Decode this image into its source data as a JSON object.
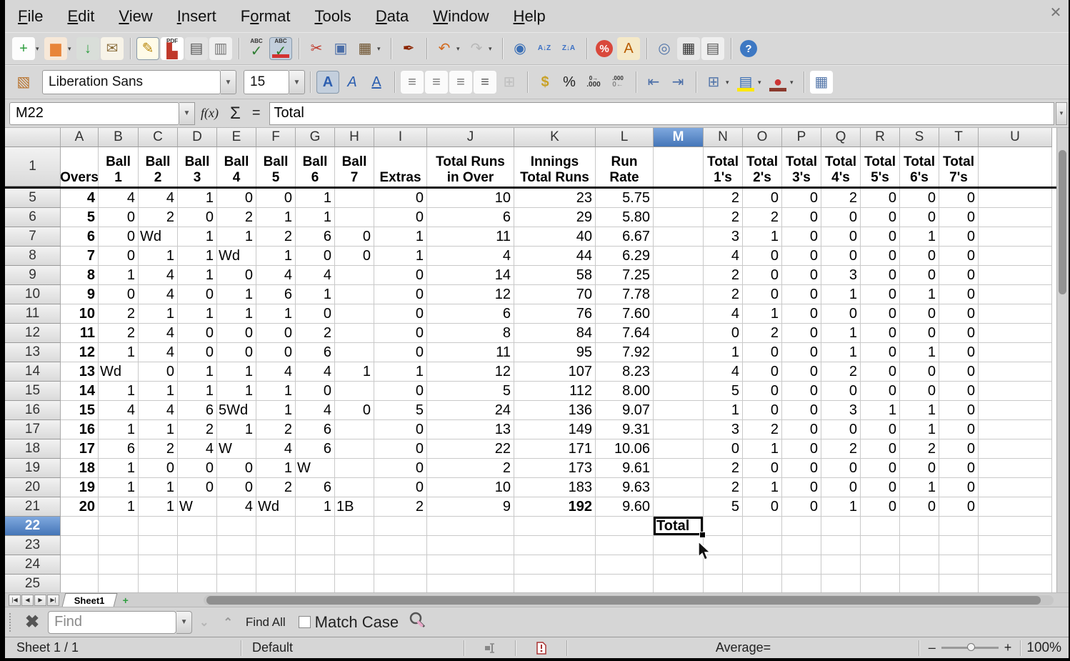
{
  "window": {
    "close_glyph": "✕"
  },
  "menu": {
    "items": [
      {
        "label": "File",
        "accel": 0
      },
      {
        "label": "Edit",
        "accel": 0
      },
      {
        "label": "View",
        "accel": 0
      },
      {
        "label": "Insert",
        "accel": 0
      },
      {
        "label": "Format",
        "accel": 1
      },
      {
        "label": "Tools",
        "accel": 0
      },
      {
        "label": "Data",
        "accel": 0
      },
      {
        "label": "Window",
        "accel": 0
      },
      {
        "label": "Help",
        "accel": 0
      }
    ]
  },
  "toolbar_standard": [
    {
      "icon": "new-document-icon",
      "glyph": "+",
      "fg": "#2e9e3f",
      "bg": "#fdfdfd",
      "dropdown": true
    },
    {
      "icon": "open-folder-icon",
      "glyph": "▆",
      "fg": "#e8853a",
      "bg": "#f7e8d8",
      "dropdown": true
    },
    {
      "icon": "save-icon",
      "glyph": "↓",
      "fg": "#2e9e3f",
      "bg": "#d9ded9"
    },
    {
      "icon": "email-icon",
      "glyph": "✉",
      "fg": "#8a6d3b",
      "bg": "#f7f3e8"
    },
    {
      "sep": true
    },
    {
      "icon": "edit-file-icon",
      "glyph": "✎",
      "fg": "#b8860b",
      "bg": "#fffbe8",
      "pressed": true
    },
    {
      "icon": "pdf-export-icon",
      "glyph": "▙",
      "top_label": "PDF",
      "fg": "#c0392b",
      "bg": "#fff"
    },
    {
      "icon": "print-icon",
      "glyph": "▤",
      "fg": "#555",
      "bg": "#e2e2e2"
    },
    {
      "icon": "print-preview-icon",
      "glyph": "▥",
      "fg": "#777",
      "bg": "#efefef"
    },
    {
      "sep": true
    },
    {
      "icon": "spellcheck-icon",
      "glyph": "✓",
      "top_label": "ABC",
      "fg": "#2e7d32"
    },
    {
      "icon": "auto-spellcheck-icon",
      "glyph": "✓",
      "top_label": "ABC",
      "fg": "#2e7d32",
      "bar": "#d33333",
      "pressed": true
    },
    {
      "sep": true
    },
    {
      "icon": "cut-icon",
      "glyph": "✂",
      "fg": "#c0392b"
    },
    {
      "icon": "copy-icon",
      "glyph": "▣",
      "fg": "#4a6da7"
    },
    {
      "icon": "paste-icon",
      "glyph": "▦",
      "fg": "#6b4f2a",
      "dropdown": true
    },
    {
      "sep": true
    },
    {
      "icon": "clone-formatting-icon",
      "glyph": "✒",
      "fg": "#8b2500"
    },
    {
      "sep": true
    },
    {
      "icon": "undo-icon",
      "glyph": "↶",
      "fg": "#d2691e",
      "dropdown": true
    },
    {
      "icon": "redo-icon",
      "glyph": "↷",
      "fg": "#888",
      "dropdown": true,
      "disabled": true
    },
    {
      "sep": true
    },
    {
      "icon": "hyperlink-icon",
      "glyph": "◉",
      "fg": "#3b6fb5"
    },
    {
      "icon": "sort-ascending-icon",
      "glyph": "A↓Z",
      "small": true,
      "fg": "#3a6fc4"
    },
    {
      "icon": "sort-descending-icon",
      "glyph": "Z↓A",
      "small": true,
      "fg": "#3a6fc4"
    },
    {
      "sep": true
    },
    {
      "icon": "chart-icon",
      "glyph": "%",
      "round": true,
      "roundbg": "#d9483b"
    },
    {
      "icon": "gallery-brush-icon",
      "glyph": "A",
      "fg": "#b85c00",
      "bg": "#f5e9c8"
    },
    {
      "sep": true
    },
    {
      "icon": "navigator-icon",
      "glyph": "◎",
      "fg": "#5577aa"
    },
    {
      "icon": "gallery-icon",
      "glyph": "▦",
      "fg": "#333",
      "bg": "#e8e8e8"
    },
    {
      "icon": "data-sources-icon",
      "glyph": "▤",
      "fg": "#555",
      "bg": "#efefef"
    },
    {
      "sep": true
    },
    {
      "icon": "help-icon",
      "glyph": "?",
      "round": true,
      "roundbg": "#3d78c3"
    }
  ],
  "toolbar_format": {
    "styles_icon": {
      "icon": "styles-icon",
      "glyph": "▧",
      "fg": "#b8722c"
    },
    "font_name": "Liberation Sans",
    "font_size": "15",
    "items": [
      {
        "sep": true
      },
      {
        "icon": "bold-icon",
        "glyph": "A",
        "fg": "#2d5fb0",
        "boldglyph": true,
        "pressed": true
      },
      {
        "icon": "italic-icon",
        "glyph": "A",
        "fg": "#2d5fb0",
        "italicglyph": true
      },
      {
        "icon": "underline-icon",
        "glyph": "A",
        "fg": "#2d5fb0",
        "underglyph": true
      },
      {
        "sep": true
      },
      {
        "icon": "align-left-icon",
        "glyph": "≡",
        "fg": "#777",
        "bg": "#fbfbfb"
      },
      {
        "icon": "align-center-icon",
        "glyph": "≡",
        "fg": "#777",
        "bg": "#fbfbfb"
      },
      {
        "icon": "align-right-icon",
        "glyph": "≡",
        "fg": "#777",
        "bg": "#fbfbfb"
      },
      {
        "icon": "align-justify-icon",
        "glyph": "≡",
        "fg": "#555",
        "bg": "#fbfbfb"
      },
      {
        "icon": "merge-cells-icon",
        "glyph": "⊞",
        "fg": "#999",
        "disabled": true
      },
      {
        "sep": true
      },
      {
        "icon": "currency-icon",
        "glyph": "$",
        "fg": "#c9a227",
        "boldglyph": true
      },
      {
        "icon": "percent-icon",
        "glyph": "%",
        "fg": "#222"
      },
      {
        "icon": "add-decimal-icon",
        "glyph": ".000",
        "small": true,
        "top_label": "0→",
        "fg": "#333"
      },
      {
        "icon": "delete-decimal-icon",
        "glyph": "0←",
        "small": true,
        "top_label": ".000",
        "fg": "#888"
      },
      {
        "sep": true
      },
      {
        "icon": "decrease-indent-icon",
        "glyph": "⇤",
        "fg": "#4a6da7"
      },
      {
        "icon": "increase-indent-icon",
        "glyph": "⇥",
        "fg": "#4a6da7"
      },
      {
        "sep": true
      },
      {
        "icon": "borders-icon",
        "glyph": "⊞",
        "fg": "#5577aa",
        "dropdown": true
      },
      {
        "icon": "background-color-icon",
        "glyph": "▤",
        "fg": "#3b6fb5",
        "bar": "#ffe800",
        "dropdown": true
      },
      {
        "icon": "border-color-icon",
        "glyph": "●",
        "fg": "#cc3333",
        "bar": "#8b3a2e",
        "dropdown": true
      },
      {
        "sep": true
      },
      {
        "icon": "conditional-formatting-icon",
        "glyph": "▦",
        "fg": "#5577aa",
        "bg": "#fff"
      }
    ]
  },
  "formula_bar": {
    "cell_reference": "M22",
    "fx_label": "f(x)",
    "sum_label": "Σ",
    "equals_label": "=",
    "content": "Total"
  },
  "spreadsheet": {
    "column_letters": [
      "A",
      "B",
      "C",
      "D",
      "E",
      "F",
      "G",
      "H",
      "I",
      "J",
      "K",
      "L",
      "M",
      "N",
      "O",
      "P",
      "Q",
      "R",
      "S",
      "T",
      "U"
    ],
    "selected_column": "M",
    "selected_row": "22",
    "cursor_cell": "M:22",
    "bold_cells": [
      "K:21",
      "M:22"
    ],
    "bold_columns": [
      "A"
    ],
    "header_row": {
      "number": "1",
      "values": [
        "Overs",
        "Ball\n1",
        "Ball\n2",
        "Ball\n3",
        "Ball\n4",
        "Ball\n5",
        "Ball\n6",
        "Ball\n7",
        "Extras",
        "Total Runs\nin Over",
        "Innings\nTotal Runs",
        "Run\nRate",
        "",
        "Total\n1's",
        "Total\n2's",
        "Total\n3's",
        "Total\n4's",
        "Total\n5's",
        "Total\n6's",
        "Total\n7's",
        ""
      ]
    },
    "rows": [
      {
        "number": "5",
        "values": [
          "4",
          "4",
          "4",
          "1",
          "0",
          "0",
          "1",
          "",
          "0",
          "10",
          "23",
          "5.75",
          "",
          "2",
          "0",
          "0",
          "2",
          "0",
          "0",
          "0",
          ""
        ]
      },
      {
        "number": "6",
        "values": [
          "5",
          "0",
          "2",
          "0",
          "2",
          "1",
          "1",
          "",
          "0",
          "6",
          "29",
          "5.80",
          "",
          "2",
          "2",
          "0",
          "0",
          "0",
          "0",
          "0",
          ""
        ]
      },
      {
        "number": "7",
        "values": [
          "6",
          "0",
          "Wd",
          "1",
          "1",
          "2",
          "6",
          "0",
          "1",
          "11",
          "40",
          "6.67",
          "",
          "3",
          "1",
          "0",
          "0",
          "0",
          "1",
          "0",
          ""
        ]
      },
      {
        "number": "8",
        "values": [
          "7",
          "0",
          "1",
          "1",
          "Wd",
          "1",
          "0",
          "0",
          "1",
          "4",
          "44",
          "6.29",
          "",
          "4",
          "0",
          "0",
          "0",
          "0",
          "0",
          "0",
          ""
        ]
      },
      {
        "number": "9",
        "values": [
          "8",
          "1",
          "4",
          "1",
          "0",
          "4",
          "4",
          "",
          "0",
          "14",
          "58",
          "7.25",
          "",
          "2",
          "0",
          "0",
          "3",
          "0",
          "0",
          "0",
          ""
        ]
      },
      {
        "number": "10",
        "values": [
          "9",
          "0",
          "4",
          "0",
          "1",
          "6",
          "1",
          "",
          "0",
          "12",
          "70",
          "7.78",
          "",
          "2",
          "0",
          "0",
          "1",
          "0",
          "1",
          "0",
          ""
        ]
      },
      {
        "number": "11",
        "values": [
          "10",
          "2",
          "1",
          "1",
          "1",
          "1",
          "0",
          "",
          "0",
          "6",
          "76",
          "7.60",
          "",
          "4",
          "1",
          "0",
          "0",
          "0",
          "0",
          "0",
          ""
        ]
      },
      {
        "number": "12",
        "values": [
          "11",
          "2",
          "4",
          "0",
          "0",
          "0",
          "2",
          "",
          "0",
          "8",
          "84",
          "7.64",
          "",
          "0",
          "2",
          "0",
          "1",
          "0",
          "0",
          "0",
          ""
        ]
      },
      {
        "number": "13",
        "values": [
          "12",
          "1",
          "4",
          "0",
          "0",
          "0",
          "6",
          "",
          "0",
          "11",
          "95",
          "7.92",
          "",
          "1",
          "0",
          "0",
          "1",
          "0",
          "1",
          "0",
          ""
        ]
      },
      {
        "number": "14",
        "values": [
          "13",
          "Wd",
          "0",
          "1",
          "1",
          "4",
          "4",
          "1",
          "1",
          "12",
          "107",
          "8.23",
          "",
          "4",
          "0",
          "0",
          "2",
          "0",
          "0",
          "0",
          ""
        ]
      },
      {
        "number": "15",
        "values": [
          "14",
          "1",
          "1",
          "1",
          "1",
          "1",
          "0",
          "",
          "0",
          "5",
          "112",
          "8.00",
          "",
          "5",
          "0",
          "0",
          "0",
          "0",
          "0",
          "0",
          ""
        ]
      },
      {
        "number": "16",
        "values": [
          "15",
          "4",
          "4",
          "6",
          "5Wd",
          "1",
          "4",
          "0",
          "5",
          "24",
          "136",
          "9.07",
          "",
          "1",
          "0",
          "0",
          "3",
          "1",
          "1",
          "0",
          ""
        ]
      },
      {
        "number": "17",
        "values": [
          "16",
          "1",
          "1",
          "2",
          "1",
          "2",
          "6",
          "",
          "0",
          "13",
          "149",
          "9.31",
          "",
          "3",
          "2",
          "0",
          "0",
          "0",
          "1",
          "0",
          ""
        ]
      },
      {
        "number": "18",
        "values": [
          "17",
          "6",
          "2",
          "4",
          "W",
          "4",
          "6",
          "",
          "0",
          "22",
          "171",
          "10.06",
          "",
          "0",
          "1",
          "0",
          "2",
          "0",
          "2",
          "0",
          ""
        ]
      },
      {
        "number": "19",
        "values": [
          "18",
          "1",
          "0",
          "0",
          "0",
          "1",
          "W",
          "",
          "0",
          "2",
          "173",
          "9.61",
          "",
          "2",
          "0",
          "0",
          "0",
          "0",
          "0",
          "0",
          ""
        ]
      },
      {
        "number": "20",
        "values": [
          "19",
          "1",
          "1",
          "0",
          "0",
          "2",
          "6",
          "",
          "0",
          "10",
          "183",
          "9.63",
          "",
          "2",
          "1",
          "0",
          "0",
          "0",
          "1",
          "0",
          ""
        ]
      },
      {
        "number": "21",
        "values": [
          "20",
          "1",
          "1",
          "W",
          "4",
          "Wd",
          "1",
          "1B",
          "2",
          "9",
          "192",
          "9.60",
          "",
          "5",
          "0",
          "0",
          "1",
          "0",
          "0",
          "0",
          ""
        ]
      },
      {
        "number": "22",
        "values": [
          "",
          "",
          "",
          "",
          "",
          "",
          "",
          "",
          "",
          "",
          "",
          "",
          "Total",
          "",
          "",
          "",
          "",
          "",
          "",
          "",
          ""
        ]
      },
      {
        "number": "23",
        "values": []
      },
      {
        "number": "24",
        "values": []
      },
      {
        "number": "25",
        "values": []
      }
    ]
  },
  "sheet_tabs": {
    "nav_glyphs": [
      "|◀",
      "◀",
      "▶",
      "▶|"
    ],
    "tabs": [
      "Sheet1"
    ],
    "add_glyph": "+"
  },
  "find_bar": {
    "close_glyph": "✖",
    "placeholder": "Find",
    "next_glyph": "⌄",
    "prev_glyph": "⌃",
    "find_all_label": "Find All",
    "match_case_label": "Match Case"
  },
  "status_bar": {
    "sheet_info": "Sheet 1 / 1",
    "page_style": "Default",
    "average_label": "Average=",
    "zoom_minus": "–",
    "zoom_plus": "+",
    "zoom_level": "100%"
  }
}
